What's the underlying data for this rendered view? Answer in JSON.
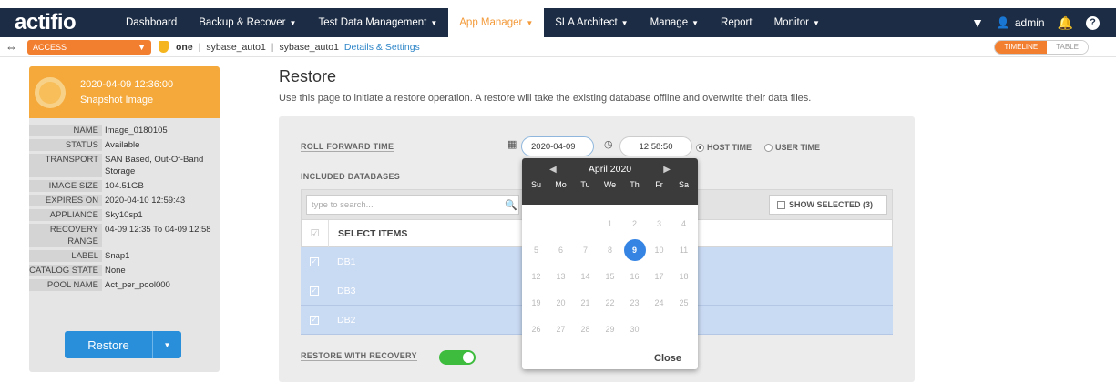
{
  "nav": {
    "logo": "actifio",
    "items": [
      {
        "label": "Dashboard",
        "caret": ""
      },
      {
        "label": "Backup & Recover",
        "caret": "▼"
      },
      {
        "label": "Test Data Management",
        "caret": "▼"
      },
      {
        "label": "App Manager",
        "caret": "▼"
      },
      {
        "label": "SLA Architect",
        "caret": "▼"
      },
      {
        "label": "Manage",
        "caret": "▼"
      },
      {
        "label": "Report",
        "caret": ""
      },
      {
        "label": "Monitor",
        "caret": "▼"
      }
    ],
    "active_index": 3,
    "user": "admin"
  },
  "subbar": {
    "access_label": "ACCESS",
    "host": "one",
    "app": "sybase_auto1",
    "app2": "sybase_auto1",
    "details_link": "Details & Settings",
    "view_timeline": "TIMELINE",
    "view_table": "TABLE"
  },
  "snapshot": {
    "datetime": "2020-04-09  12:36:00",
    "type": "Snapshot Image",
    "properties": [
      {
        "key": "NAME",
        "value": "Image_0180105"
      },
      {
        "key": "STATUS",
        "value": "Available"
      },
      {
        "key": "TRANSPORT",
        "value": "SAN Based, Out-Of-Band Storage"
      },
      {
        "key": "IMAGE SIZE",
        "value": "104.51GB"
      },
      {
        "key": "EXPIRES ON",
        "value": "2020-04-10 12:59:43"
      },
      {
        "key": "APPLIANCE",
        "value": "Sky10sp1"
      },
      {
        "key": "RECOVERY RANGE",
        "value": "04-09 12:35 To 04-09 12:58"
      },
      {
        "key": "LABEL",
        "value": "Snap1"
      },
      {
        "key": "CATALOG STATE",
        "value": "None"
      },
      {
        "key": "POOL NAME",
        "value": "Act_per_pool000"
      }
    ],
    "restore_button": "Restore"
  },
  "restore": {
    "title": "Restore",
    "description": "Use this page to initiate a restore operation. A restore will take the existing database offline and overwrite their data files.",
    "roll_forward_label": "ROLL FORWARD TIME",
    "date_value": "2020-04-09",
    "time_value": "12:58:50",
    "host_time_label": "HOST TIME",
    "user_time_label": "USER TIME",
    "included_db_label": "INCLUDED DATABASES",
    "search_placeholder": "type to search...",
    "show_selected_label": "SHOW SELECTED (3)",
    "select_items_label": "SELECT ITEMS",
    "databases": [
      "DB1",
      "DB3",
      "DB2"
    ],
    "restore_with_recovery_label": "RESTORE WITH RECOVERY"
  },
  "calendar": {
    "month_label": "April 2020",
    "dow": [
      "Su",
      "Mo",
      "Tu",
      "We",
      "Th",
      "Fr",
      "Sa"
    ],
    "weeks": [
      [
        "",
        "",
        "",
        "1",
        "2",
        "3",
        "4"
      ],
      [
        "5",
        "6",
        "7",
        "8",
        "9",
        "10",
        "11"
      ],
      [
        "12",
        "13",
        "14",
        "15",
        "16",
        "17",
        "18"
      ],
      [
        "19",
        "20",
        "21",
        "22",
        "23",
        "24",
        "25"
      ],
      [
        "26",
        "27",
        "28",
        "29",
        "30",
        "",
        ""
      ]
    ],
    "selected": "9",
    "close_label": "Close"
  },
  "colors": {
    "navbar": "#1c2c44",
    "accent_orange": "#f27e2f",
    "snapshot_header": "#f4a93a",
    "primary_blue": "#2a8fdb",
    "selected_row": "#c9daf3",
    "toggle_on": "#3ebc3e"
  }
}
